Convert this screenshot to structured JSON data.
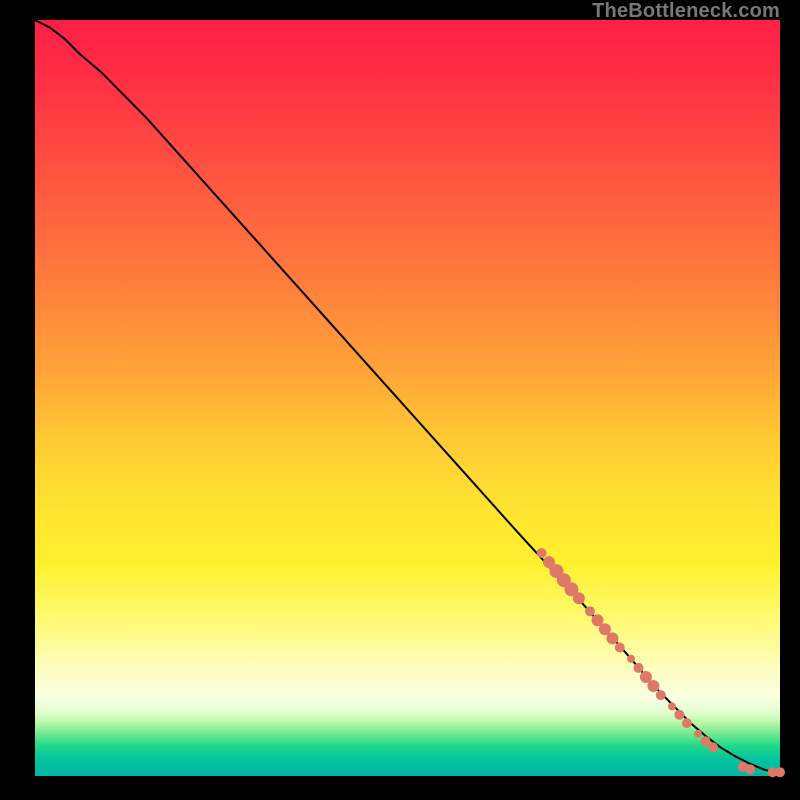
{
  "watermark": "TheBottleneck.com",
  "colors": {
    "curve": "#000000",
    "marker_fill": "#e07868",
    "marker_stroke": "#c85a4a",
    "bg": "#000000"
  },
  "chart_data": {
    "type": "line",
    "title": "",
    "xlabel": "",
    "ylabel": "",
    "xlim": [
      0,
      100
    ],
    "ylim": [
      0,
      100
    ],
    "grid": false,
    "legend": false,
    "curve_comment": "y expressed as percentage of plot height from bottom; x as percentage from left",
    "series": [
      {
        "name": "curve",
        "x": [
          0,
          2,
          4,
          6,
          9,
          15,
          25,
          35,
          45,
          55,
          65,
          72,
          76,
          80,
          83,
          86,
          88,
          90,
          92,
          94,
          96,
          98,
          100
        ],
        "y": [
          100,
          99,
          97.5,
          95.5,
          93,
          87,
          76,
          65,
          54,
          43,
          32,
          24.5,
          20,
          15.5,
          12,
          9,
          7,
          5.3,
          3.8,
          2.6,
          1.6,
          0.8,
          0.5
        ]
      }
    ],
    "markers_comment": "clustered points along lower-right of curve; same x/y % convention",
    "markers": [
      {
        "x": 68,
        "y": 29.5,
        "r": 5
      },
      {
        "x": 69,
        "y": 28.3,
        "r": 6
      },
      {
        "x": 70,
        "y": 27.1,
        "r": 7
      },
      {
        "x": 71,
        "y": 25.9,
        "r": 7
      },
      {
        "x": 72,
        "y": 24.7,
        "r": 7
      },
      {
        "x": 73,
        "y": 23.5,
        "r": 6
      },
      {
        "x": 74.5,
        "y": 21.8,
        "r": 5
      },
      {
        "x": 75.5,
        "y": 20.6,
        "r": 6
      },
      {
        "x": 76.5,
        "y": 19.4,
        "r": 6
      },
      {
        "x": 77.5,
        "y": 18.2,
        "r": 6
      },
      {
        "x": 78.5,
        "y": 17.0,
        "r": 5
      },
      {
        "x": 80,
        "y": 15.5,
        "r": 4
      },
      {
        "x": 81,
        "y": 14.3,
        "r": 5
      },
      {
        "x": 82,
        "y": 13.1,
        "r": 6
      },
      {
        "x": 83,
        "y": 11.9,
        "r": 6
      },
      {
        "x": 84,
        "y": 10.7,
        "r": 5
      },
      {
        "x": 85.5,
        "y": 9.2,
        "r": 4
      },
      {
        "x": 86.5,
        "y": 8.1,
        "r": 5
      },
      {
        "x": 87.5,
        "y": 7.0,
        "r": 5
      },
      {
        "x": 89,
        "y": 5.6,
        "r": 4
      },
      {
        "x": 90,
        "y": 4.6,
        "r": 5
      },
      {
        "x": 91,
        "y": 3.8,
        "r": 5
      },
      {
        "x": 95,
        "y": 1.2,
        "r": 5
      },
      {
        "x": 96,
        "y": 0.9,
        "r": 5
      },
      {
        "x": 99,
        "y": 0.5,
        "r": 5
      },
      {
        "x": 100,
        "y": 0.5,
        "r": 5
      }
    ]
  }
}
